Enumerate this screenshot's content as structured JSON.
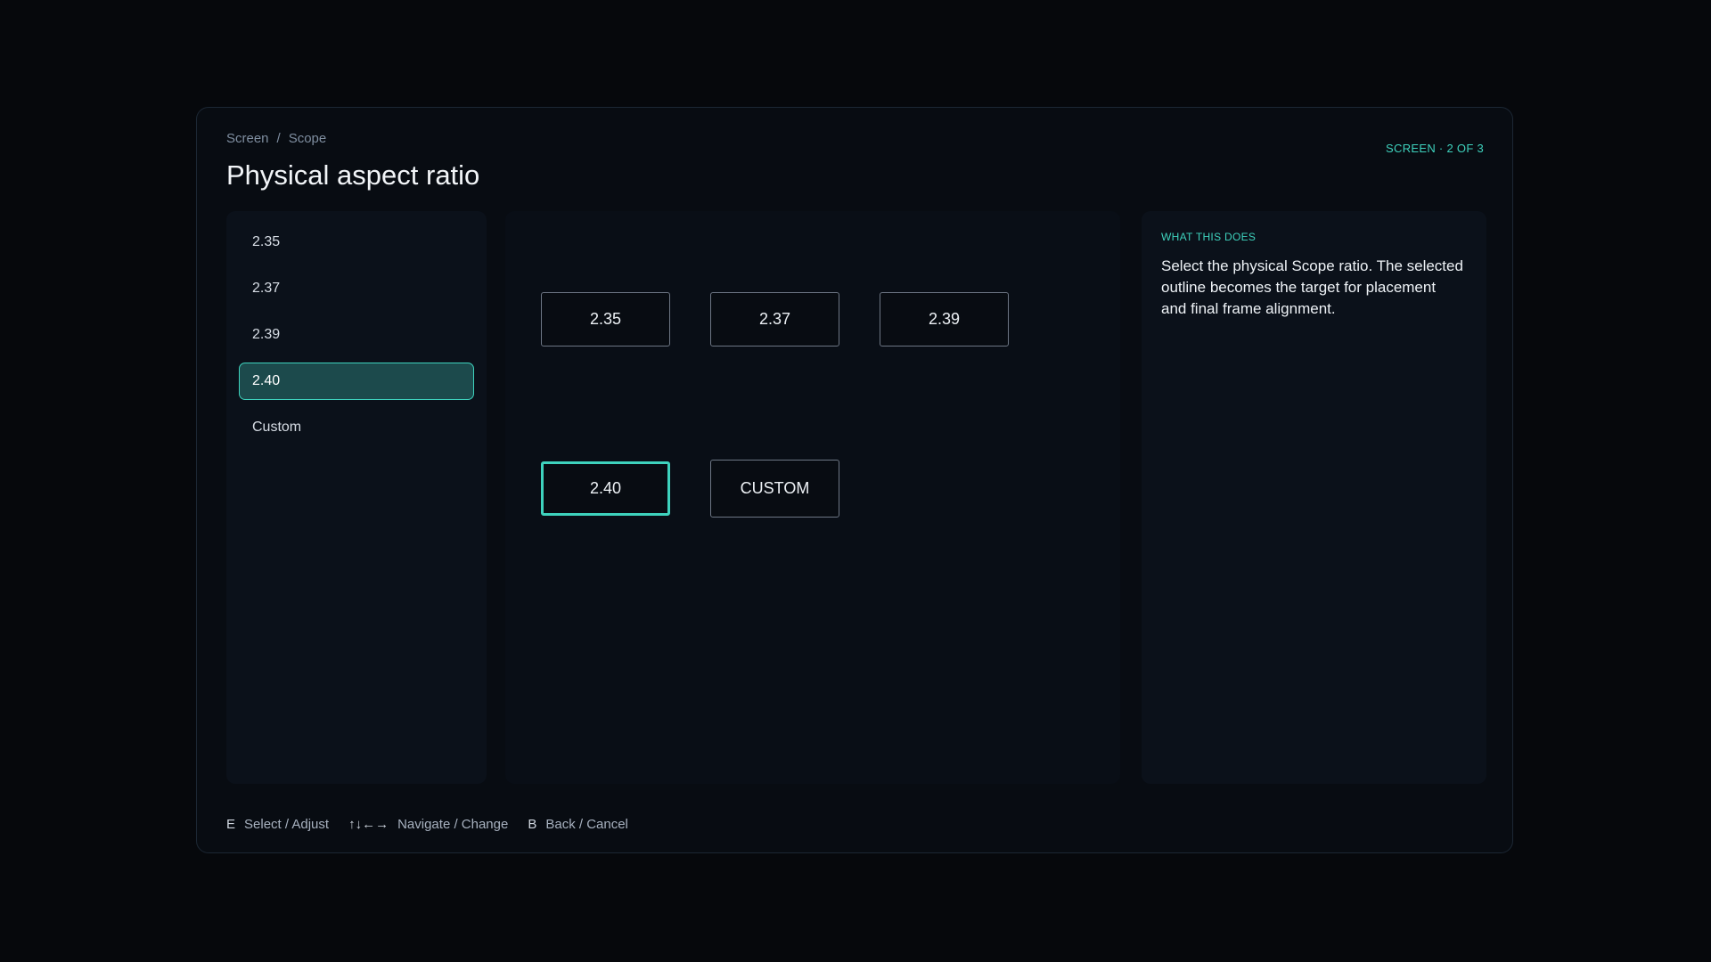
{
  "breadcrumb": {
    "items": [
      "Screen",
      "Scope"
    ],
    "separator": "/"
  },
  "page": {
    "title": "Physical aspect ratio",
    "counter": "SCREEN · 2 OF 3"
  },
  "options_list": {
    "items": [
      {
        "label": "2.35",
        "selected": false
      },
      {
        "label": "2.37",
        "selected": false
      },
      {
        "label": "2.39",
        "selected": false
      },
      {
        "label": "2.40",
        "selected": true
      },
      {
        "label": "Custom",
        "selected": false
      }
    ]
  },
  "ratio_grid": {
    "buttons": [
      {
        "label": "2.35",
        "selected": false
      },
      {
        "label": "2.37",
        "selected": false
      },
      {
        "label": "2.39",
        "selected": false
      },
      {
        "label": "2.40",
        "selected": true
      },
      {
        "label": "CUSTOM",
        "selected": false
      }
    ]
  },
  "info": {
    "heading": "WHAT THIS DOES",
    "body": "Select the physical Scope ratio. The selected outline becomes the target for placement and final frame alignment."
  },
  "footer": {
    "hints": [
      {
        "key": "E",
        "action": "Select / Adjust"
      },
      {
        "key": "↑↓←→",
        "action": "Navigate / Change"
      },
      {
        "key": "B",
        "action": "Back / Cancel"
      }
    ]
  },
  "colors": {
    "accent": "#3ed2bd",
    "selected_fill": "#1c4a4c",
    "background": "#06080c",
    "panel": "#0b111a"
  }
}
